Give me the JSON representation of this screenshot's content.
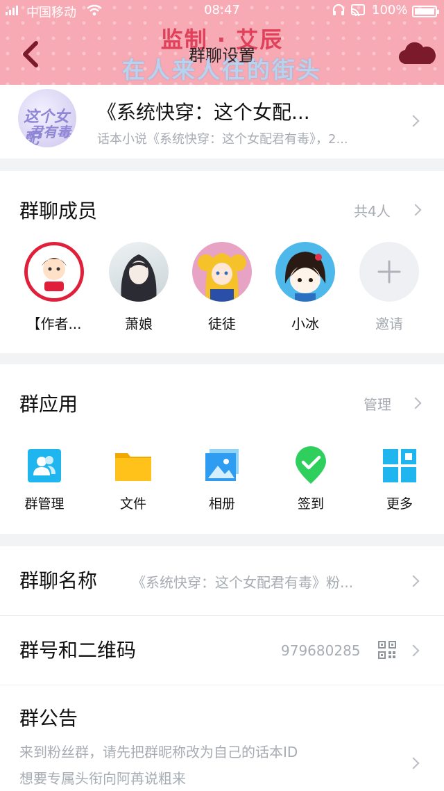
{
  "status_bar": {
    "carrier": "中国移动",
    "time": "08:47",
    "battery": "100%"
  },
  "header": {
    "title": "群聊设置",
    "watermark_line1": "监制 · 艾辰",
    "watermark_line2": "在人来人往的街头"
  },
  "novel": {
    "name": "《系统快穿：这个女配...",
    "description": "话本小说《系统快穿：这个女配君有毒》，2...",
    "cover_line1": "这个女配",
    "cover_line2": "君有毒"
  },
  "members": {
    "heading": "群聊成员",
    "count": "共4人",
    "list": [
      {
        "name": "【作者..."
      },
      {
        "name": "萧娘"
      },
      {
        "name": "徒徒"
      },
      {
        "name": "小冰"
      }
    ],
    "invite_label": "邀请"
  },
  "apps": {
    "heading": "群应用",
    "manage_label": "管理",
    "items": [
      {
        "label": "群管理",
        "icon": "group-manage-icon"
      },
      {
        "label": "文件",
        "icon": "folder-icon"
      },
      {
        "label": "相册",
        "icon": "photo-album-icon"
      },
      {
        "label": "签到",
        "icon": "check-in-icon"
      },
      {
        "label": "更多",
        "icon": "more-apps-icon"
      }
    ]
  },
  "settings": {
    "group_name_label": "群聊名称",
    "group_name_value": "《系统快穿：这个女配君有毒》粉...",
    "group_id_label": "群号和二维码",
    "group_id_value": "979680285",
    "announcement_label": "群公告",
    "announcement_line1": "来到粉丝群，请先把群昵称改为自己的话本ID",
    "announcement_line2": "想要专属头衔向阿苒说粗来"
  },
  "colors": {
    "header_pink": "#f7a9b4",
    "accent_blue": "#1fb6f0",
    "folder_yellow": "#ffc21a",
    "check_green": "#2fcf5e"
  }
}
